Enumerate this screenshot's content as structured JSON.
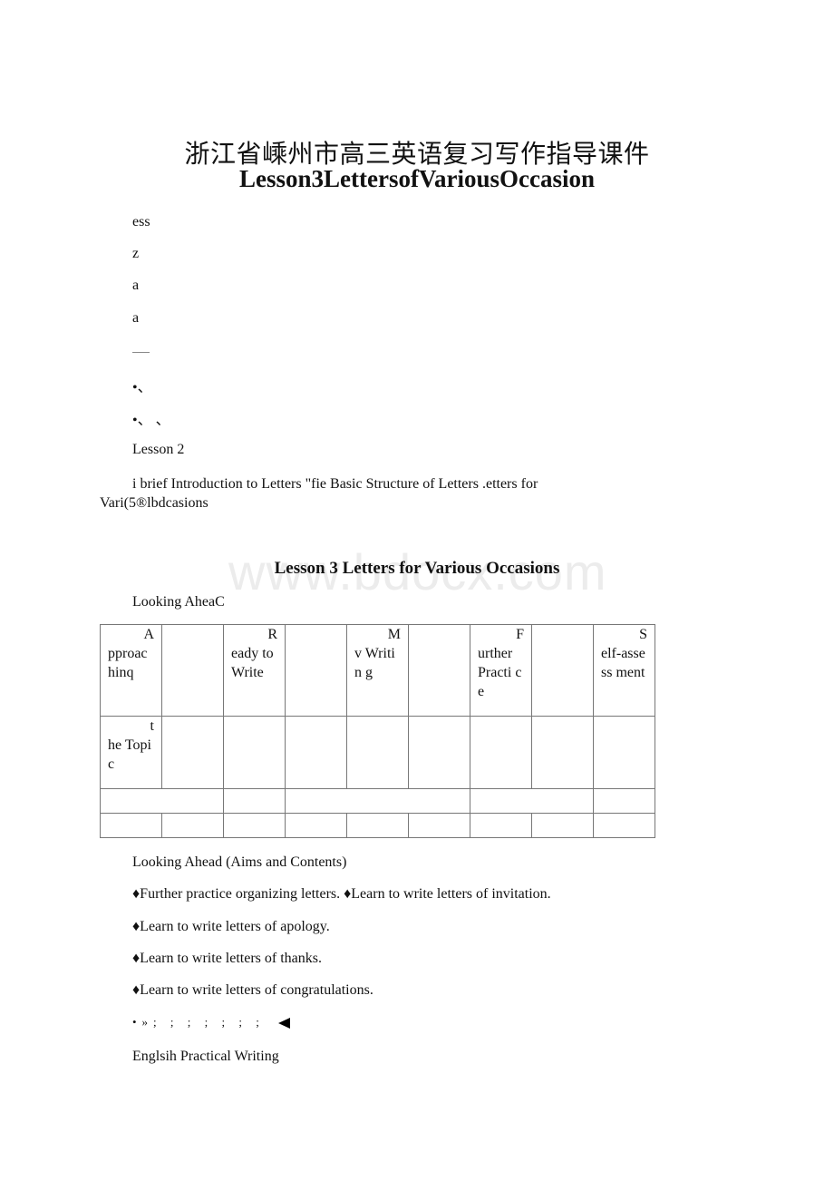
{
  "document": {
    "title_cn": "浙江省嵊州市高三英语复习写作指导课件",
    "title_en": "Lesson3LettersofVariousOccasion",
    "fragments": [
      "ess",
      "z",
      "a",
      "a"
    ],
    "bullet_fragments": [
      "•、",
      "•、 、"
    ],
    "lesson_label": "Lesson 2",
    "intro_paragraph": "i brief Introduction to Letters \"fie Basic Structure of Letters .etters for Vari(5®lbdcasions",
    "watermark": "www.bdocx.com",
    "section_heading": "Lesson 3 Letters for Various Occasions",
    "looking_ahead_label": "Looking AheaC",
    "table": {
      "header_row": [
        {
          "first": "A",
          "rest": "pproac hinq"
        },
        {
          "first": "",
          "rest": ""
        },
        {
          "first": "R",
          "rest": "eady to Write"
        },
        {
          "first": "",
          "rest": ""
        },
        {
          "first": "M",
          "rest": "v Writin g"
        },
        {
          "first": "",
          "rest": ""
        },
        {
          "first": "F",
          "rest": "urther Practi ce"
        },
        {
          "first": "",
          "rest": ""
        },
        {
          "first": "S",
          "rest": "elf-assess ment"
        }
      ],
      "second_row": [
        {
          "first": "t",
          "rest": "he Topic"
        }
      ]
    },
    "aims_heading": "Looking Ahead (Aims and Contents)",
    "aims": [
      "♦Further practice organizing letters. ♦Learn to write letters of invitation.",
      "♦Learn to write letters of apology.",
      "♦Learn to write letters of thanks.",
      "♦Learn to write letters of congratulations."
    ],
    "symbol_line": "•»; ; ; ; ; ; ;",
    "footer_text": "Englsih Practical Writing"
  }
}
